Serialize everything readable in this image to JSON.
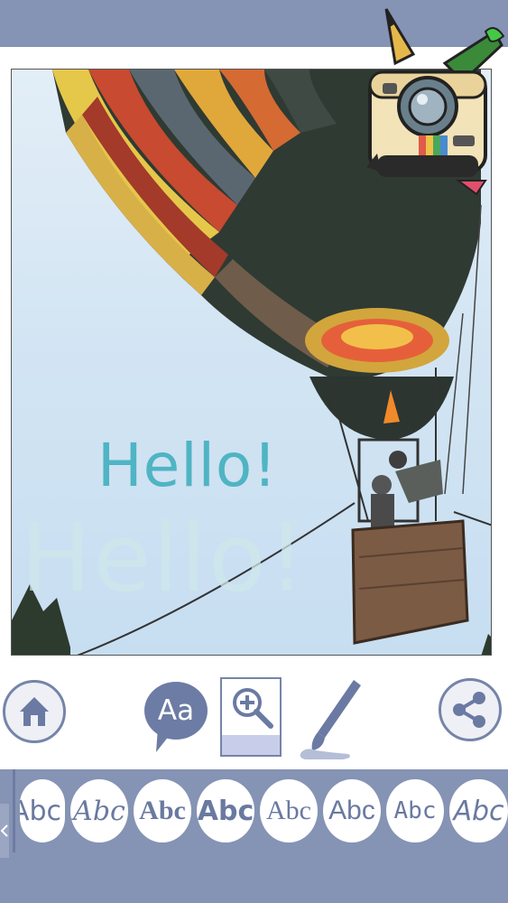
{
  "photo": {
    "overlay_text": "Hello!",
    "overlay_text_ghost": "Hello!"
  },
  "toolbar": {
    "home": {
      "icon": "home-icon"
    },
    "text_button": {
      "label": "Aa",
      "icon": "speech-bubble-icon"
    },
    "zoom": {
      "icon": "zoom-in-icon"
    },
    "brush": {
      "icon": "paintbrush-icon"
    },
    "share": {
      "icon": "share-icon"
    }
  },
  "font_samples": [
    "Abc",
    "Abc",
    "Abc",
    "Abc",
    "Abc",
    "Abc",
    "Abc",
    "Abc"
  ],
  "colors": {
    "bar": "#8593b4",
    "accent": "#6c7ca4",
    "text_teal": "#4fb4c3"
  }
}
